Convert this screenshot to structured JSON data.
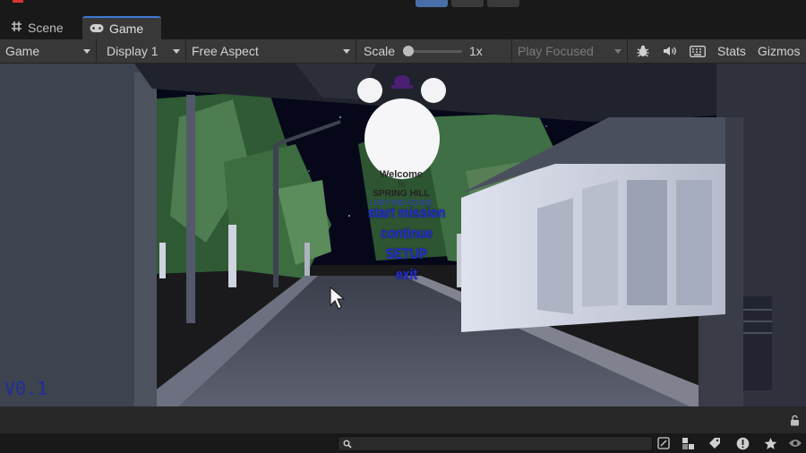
{
  "tabs": [
    {
      "icon": "grid-icon",
      "label": "Scene",
      "active": false
    },
    {
      "icon": "gamepad-icon",
      "label": "Game",
      "active": true
    }
  ],
  "toolbar": {
    "view_select": "Game",
    "display_select": "Display 1",
    "aspect_select": "Free Aspect",
    "scale_label": "Scale",
    "scale_value": "1x",
    "play_mode_select": "Play Focused",
    "stats_label": "Stats",
    "gizmos_label": "Gizmos"
  },
  "game": {
    "logo": {
      "line1": "Welcome",
      "line2": "To",
      "line3": "SPRING HILL",
      "line4": "LOST AND FOUND"
    },
    "menu": [
      "start mission",
      "continue",
      "SETUP",
      "exit"
    ],
    "version": "V0.1"
  },
  "colors": {
    "accent": "#3c7bd2",
    "menu_text": "#2530c8",
    "toolbar_bg": "#383838"
  }
}
